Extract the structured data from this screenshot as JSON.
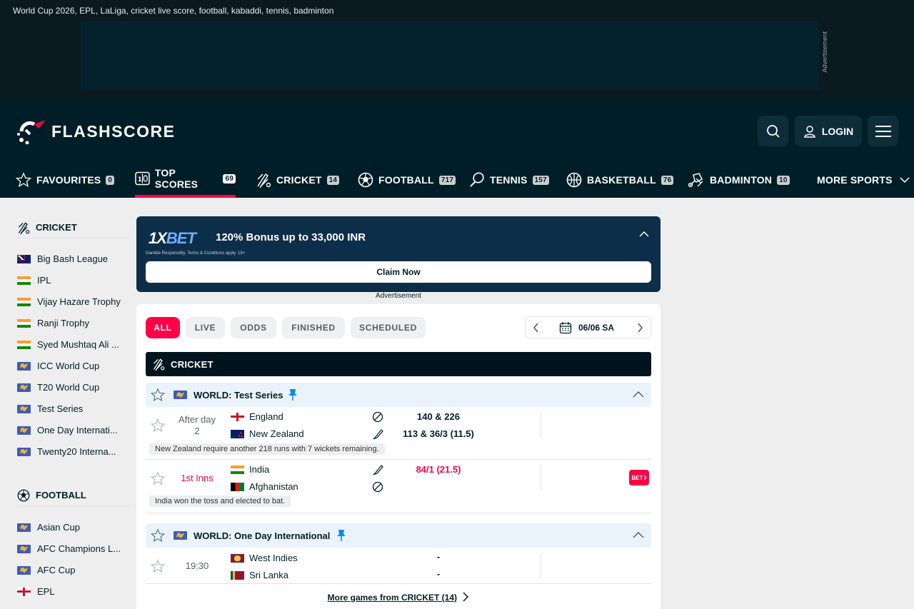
{
  "tagline": "World Cup 2026, EPL, LaLiga, cricket live score, football, kabaddi, tennis, badminton",
  "ad_top_label": "Advertisement",
  "brand": {
    "name": "FLASHSCORE",
    "accent": "#ff0046"
  },
  "header": {
    "login_label": "LOGIN"
  },
  "nav": [
    {
      "label": "FAVOURITES",
      "badge": "0",
      "icon": "star-icon"
    },
    {
      "label": "TOP SCORES",
      "badge": "69",
      "icon": "scoreboard-icon",
      "active": true
    },
    {
      "label": "CRICKET",
      "badge": "14",
      "icon": "cricket-icon"
    },
    {
      "label": "FOOTBALL",
      "badge": "717",
      "icon": "football-icon"
    },
    {
      "label": "TENNIS",
      "badge": "157",
      "icon": "tennis-icon"
    },
    {
      "label": "BASKETBALL",
      "badge": "76",
      "icon": "basketball-icon"
    },
    {
      "label": "BADMINTON",
      "badge": "10",
      "icon": "badminton-icon"
    },
    {
      "label": "MORE SPORTS",
      "icon": "chevron-down-icon"
    }
  ],
  "sidebar": {
    "cricket": {
      "title": "CRICKET",
      "items": [
        {
          "label": "Big Bash League",
          "flag": "au"
        },
        {
          "label": "IPL",
          "flag": "in"
        },
        {
          "label": "Vijay Hazare Trophy",
          "flag": "in"
        },
        {
          "label": "Ranji Trophy",
          "flag": "in"
        },
        {
          "label": "Syed Mushtaq Ali ...",
          "flag": "in"
        },
        {
          "label": "ICC World Cup",
          "flag": "world"
        },
        {
          "label": "T20 World Cup",
          "flag": "world"
        },
        {
          "label": "Test Series",
          "flag": "world"
        },
        {
          "label": "One Day Internati...",
          "flag": "world"
        },
        {
          "label": "Twenty20 Interna...",
          "flag": "world"
        }
      ]
    },
    "football": {
      "title": "FOOTBALL",
      "items": [
        {
          "label": "Asian Cup",
          "flag": "world"
        },
        {
          "label": "AFC Champions L...",
          "flag": "world"
        },
        {
          "label": "AFC Cup",
          "flag": "world"
        },
        {
          "label": "EPL",
          "flag": "en"
        }
      ]
    }
  },
  "promo": {
    "logo_main": "1X",
    "logo_accent": "BET",
    "title": "120% Bonus up to 33,000 INR",
    "small_print": "Gamble Responsibly. Terms & Conditions apply. 18+",
    "cta": "Claim Now",
    "ad_label": "Advertisement"
  },
  "filters": [
    "ALL",
    "LIVE",
    "ODDS",
    "FINISHED",
    "SCHEDULED"
  ],
  "date": "06/06 SA",
  "sport_section": "CRICKET",
  "leagues": [
    {
      "name": "WORLD: Test Series",
      "matches": [
        {
          "status": "After day 2",
          "home": {
            "name": "England",
            "flag": "en",
            "score": "140 & 226"
          },
          "away": {
            "name": "New Zealand",
            "flag": "nz",
            "score": "113 & 36/3 (11.5)"
          },
          "note": "New Zealand require another 218 runs with 7 wickets remaining."
        },
        {
          "status": "1st Inns",
          "home": {
            "name": "India",
            "flag": "in",
            "score": "84/1 (21.5)"
          },
          "away": {
            "name": "Afghanistan",
            "flag": "af",
            "score": ""
          },
          "note": "India won the toss and elected to bat.",
          "bet": "BET"
        }
      ]
    },
    {
      "name": "WORLD: One Day International",
      "matches": [
        {
          "status": "19:30",
          "home": {
            "name": "West Indies",
            "flag": "wi",
            "score": "-"
          },
          "away": {
            "name": "Sri Lanka",
            "flag": "lk",
            "score": "-"
          }
        }
      ]
    }
  ],
  "more_games": "More games from CRICKET (14)"
}
